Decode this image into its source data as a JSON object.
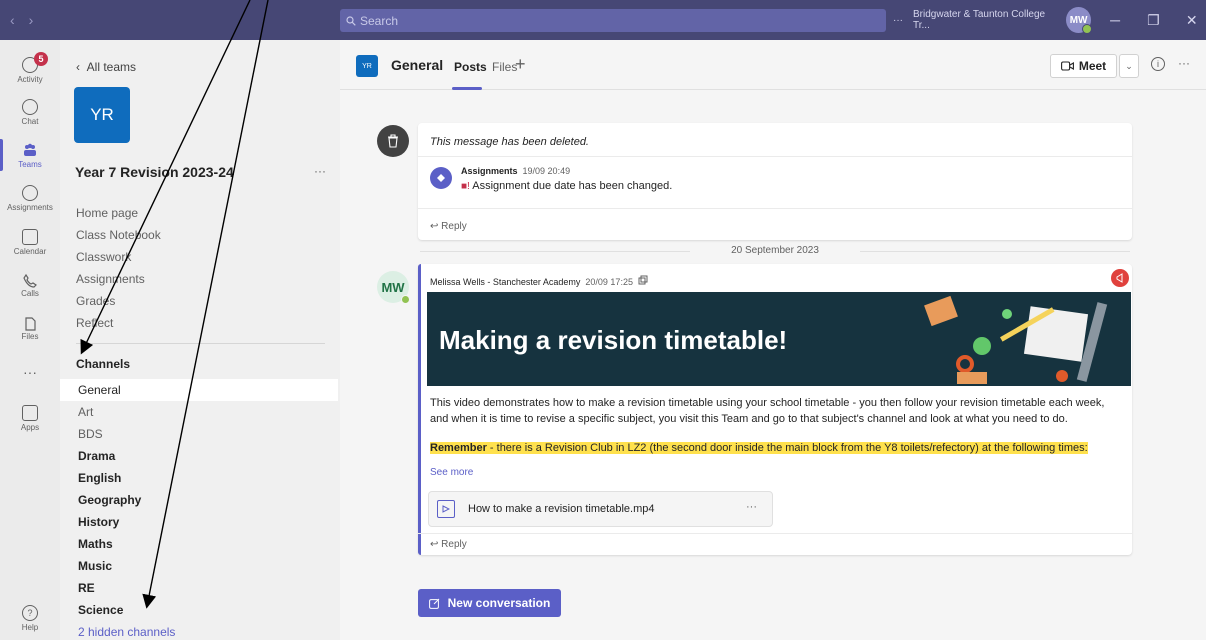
{
  "titlebar": {
    "search_placeholder": "Search",
    "more": "···",
    "org_name": "Bridgwater & Taunton College Tr...",
    "user_initials": "MW",
    "minimize": "─",
    "restore": "❐",
    "close": "✕",
    "back": "‹",
    "forward": "›"
  },
  "rail": {
    "items": [
      {
        "label": "Activity",
        "badge": "5"
      },
      {
        "label": "Chat"
      },
      {
        "label": "Teams"
      },
      {
        "label": "Assignments"
      },
      {
        "label": "Calendar"
      },
      {
        "label": "Calls"
      },
      {
        "label": "Files"
      },
      {
        "label": "···"
      },
      {
        "label": "Apps"
      },
      {
        "label": "Help"
      }
    ]
  },
  "team": {
    "back_label": "All teams",
    "avatar_text": "YR",
    "name": "Year 7 Revision 2023-24",
    "more": "···",
    "links": [
      "Home page",
      "Class Notebook",
      "Classwork",
      "Assignments",
      "Grades",
      "Reflect"
    ],
    "channels_header": "Channels",
    "channels": [
      {
        "name": "General",
        "style": "sel"
      },
      {
        "name": "Art",
        "style": "normal"
      },
      {
        "name": "BDS",
        "style": "normal"
      },
      {
        "name": "Drama",
        "style": "bold"
      },
      {
        "name": "English",
        "style": "bold"
      },
      {
        "name": "Geography",
        "style": "bold"
      },
      {
        "name": "History",
        "style": "bold"
      },
      {
        "name": "Maths",
        "style": "bold"
      },
      {
        "name": "Music",
        "style": "bold"
      },
      {
        "name": "RE",
        "style": "bold"
      },
      {
        "name": "Science",
        "style": "bold"
      }
    ],
    "hidden_channels": "2 hidden channels"
  },
  "header": {
    "avatar_text": "YR",
    "channel": "General",
    "tabs": [
      "Posts",
      "Files"
    ],
    "add_tab": "+",
    "meet_label": "Meet",
    "more": "···"
  },
  "posts": {
    "deleted": {
      "text": "This message has been deleted.",
      "reply_author": "Assignments",
      "reply_time": "19/09 20:49",
      "reply_text": "Assignment due date has been changed.",
      "reply_label": "Reply"
    },
    "date_separator": "20 September 2023",
    "main": {
      "avatar": "MW",
      "author": "Melissa Wells - Stanchester Academy",
      "time": "20/09 17:25",
      "banner_title": "Making a revision timetable!",
      "body": "This video demonstrates how to make a revision timetable using your school timetable - you then follow your revision timetable each week, and when it is time to revise a specific subject, you visit this Team and go to that subject's channel and look at what you need to do.",
      "remember_bold": "Remember",
      "remember_rest": " - there is a Revision Club in LZ2 (the second door inside the main block from the Y8 toilets/refectory) at the following times:",
      "see_more": "See more",
      "attachment": "How to make a revision timetable.mp4",
      "attachment_more": "···",
      "reply_label": "Reply"
    }
  },
  "new_conversation": "New conversation",
  "colors": {
    "titlebar": "#464775",
    "accent": "#5b5fc7",
    "team_avatar": "#0f6cbd",
    "highlight": "#ffe14d",
    "banner": "#16333f"
  }
}
